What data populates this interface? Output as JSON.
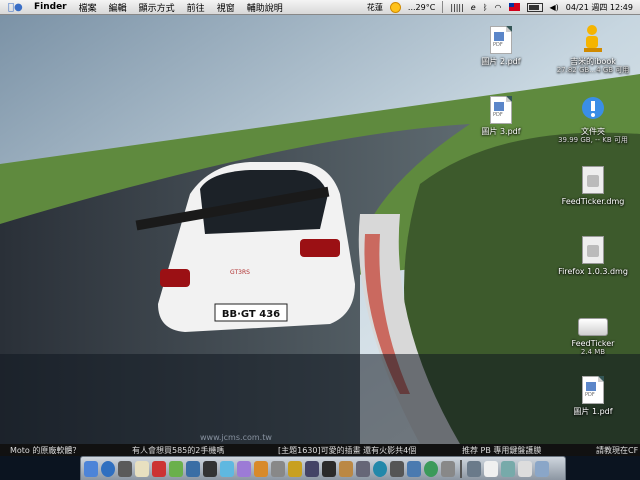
{
  "menubar": {
    "app_name": "Finder",
    "items": [
      "檔案",
      "編輯",
      "顯示方式",
      "前往",
      "視窗",
      "輔助說明"
    ],
    "weather_city": "花蓮",
    "weather_temp": "...29°C",
    "date_time": "04/21 週四 12:49"
  },
  "desktop_icons": [
    {
      "label": "圖片 2.pdf",
      "sub": ""
    },
    {
      "label": "吉米的ibook",
      "sub": "27.82 GB…4 GB 可用"
    },
    {
      "label": "圖片 3.pdf",
      "sub": ""
    },
    {
      "label": "文件夾",
      "sub": "39.99 GB, -- KB 可用"
    },
    {
      "label": "FeedTicker.dmg",
      "sub": ""
    },
    {
      "label": "Firefox 1.0.3.dmg",
      "sub": ""
    },
    {
      "label": "FeedTicker",
      "sub": "2.4 MB"
    },
    {
      "label": "圖片 1.pdf",
      "sub": ""
    }
  ],
  "wallpaper": {
    "license_plate": "BB·GT 436",
    "badge": "GT3RS",
    "watermark": "www.jcms.com.tw"
  },
  "ticker": [
    "Moto 的原廠軟體？",
    "有人會想買585的2手機嗎",
    "[主題1630]可愛的插畫 還有火影共4個",
    "推荐 PB 專用鍵盤護膜",
    "請教現在CF G"
  ]
}
